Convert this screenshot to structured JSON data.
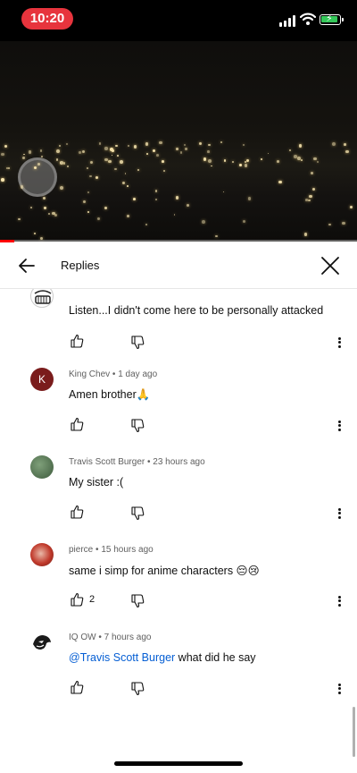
{
  "status_bar": {
    "time": "10:20",
    "accent": "#e7343d",
    "battery_color": "#34c759"
  },
  "video": {
    "progress": 0.04,
    "progress_color": "#ff0000"
  },
  "header": {
    "title": "Replies"
  },
  "comments": [
    {
      "author": "",
      "time": "",
      "text": "Listen...I didn't come here to be personally attacked",
      "likes": "",
      "avatar": "cartoon-face"
    },
    {
      "author": "King Chev",
      "time": "1 day ago",
      "text": "Amen brother🙏",
      "likes": "",
      "avatar_letter": "K",
      "avatar_color": "#7a1c1c"
    },
    {
      "author": "Travis Scott Burger",
      "time": "23 hours ago",
      "text": "My sister :(",
      "likes": "",
      "avatar": "green-photo"
    },
    {
      "author": "pierce",
      "time": "15 hours ago",
      "text": "same i simp for anime characters 😔😢",
      "likes": "2",
      "avatar": "red-character"
    },
    {
      "author": "IQ OW",
      "time": "7 hours ago",
      "mention": "@Travis Scott Burger",
      "text": " what did he say",
      "likes": "",
      "avatar": "white-mascot"
    }
  ],
  "separator": " • ",
  "icons": {
    "back": "arrow-left-icon",
    "close": "close-icon",
    "like": "thumbs-up-icon",
    "dislike": "thumbs-down-icon",
    "more": "more-vertical-icon"
  }
}
